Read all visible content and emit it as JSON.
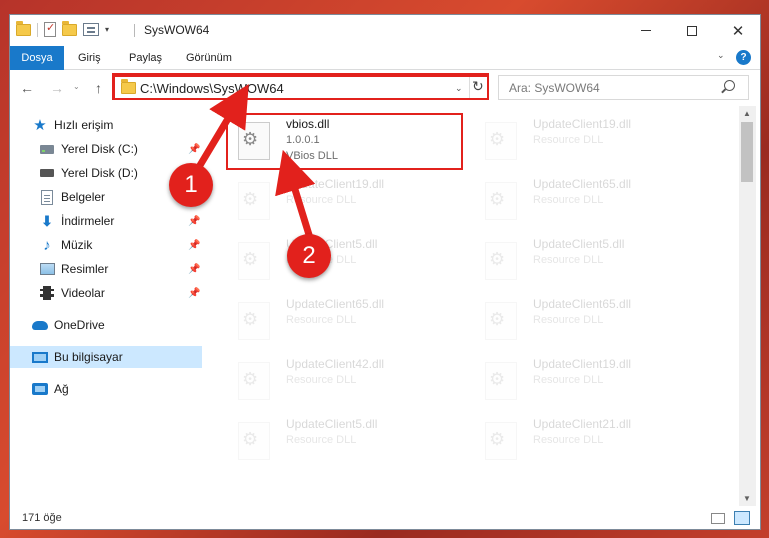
{
  "window": {
    "title": "SysWOW64",
    "controls": {
      "minimize": "—",
      "maximize": "☐",
      "close": "✕"
    }
  },
  "ribbon": {
    "tabs": [
      "Dosya",
      "Giriş",
      "Paylaş",
      "Görünüm"
    ],
    "help": "?",
    "expand": "⌄"
  },
  "navigation": {
    "back": "←",
    "forward": "→",
    "history": "⌄",
    "up": "↑",
    "address": "C:\\Windows\\SysWOW64",
    "address_dropdown": "⌄",
    "refresh": "↻",
    "search_placeholder": "Ara: SysWOW64"
  },
  "sidebar": {
    "items": [
      {
        "label": "Hızlı erişim",
        "icon": "star-icon"
      },
      {
        "label": "Yerel Disk (C:)",
        "icon": "drive-icon",
        "pinned": true
      },
      {
        "label": "Yerel Disk (D:)",
        "icon": "drive-icon"
      },
      {
        "label": "Belgeler",
        "icon": "documents-icon",
        "pinned": true
      },
      {
        "label": "İndirmeler",
        "icon": "download-icon",
        "pinned": true
      },
      {
        "label": "Müzik",
        "icon": "music-icon",
        "pinned": true
      },
      {
        "label": "Resimler",
        "icon": "pictures-icon",
        "pinned": true
      },
      {
        "label": "Videolar",
        "icon": "video-icon",
        "pinned": true
      },
      {
        "label": "OneDrive",
        "icon": "cloud-icon"
      },
      {
        "label": "Bu bilgisayar",
        "icon": "computer-icon",
        "selected": true
      },
      {
        "label": "Ağ",
        "icon": "network-icon"
      }
    ],
    "pin_glyph": "📌"
  },
  "files": [
    {
      "name": "vbios.dll",
      "version": "1.0.0.1",
      "description": "VBios DLL",
      "highlighted": true
    },
    {
      "name": "UpdateClient19.dll",
      "description": "Resource DLL"
    },
    {
      "name": "UpdateClient19.dll",
      "description": "Resource DLL"
    },
    {
      "name": "UpdateClient65.dll",
      "description": "Resource DLL"
    },
    {
      "name": "UpdateClient5.dll",
      "description": "Resource DLL"
    },
    {
      "name": "UpdateClient5.dll",
      "description": "Resource DLL"
    },
    {
      "name": "UpdateClient65.dll",
      "description": "Resource DLL"
    },
    {
      "name": "UpdateClient65.dll",
      "description": "Resource DLL"
    },
    {
      "name": "UpdateClient42.dll",
      "description": "Resource DLL"
    },
    {
      "name": "UpdateClient19.dll",
      "description": "Resource DLL"
    },
    {
      "name": "UpdateClient5.dll",
      "description": "Resource DLL"
    },
    {
      "name": "UpdateClient21.dll",
      "description": "Resource DLL"
    }
  ],
  "status": {
    "item_count": "171 öğe"
  },
  "annotations": {
    "badge_1": "1",
    "badge_2": "2"
  },
  "colors": {
    "accent": "#1979ca",
    "highlight": "#e2211c",
    "selection": "#cce8ff"
  }
}
